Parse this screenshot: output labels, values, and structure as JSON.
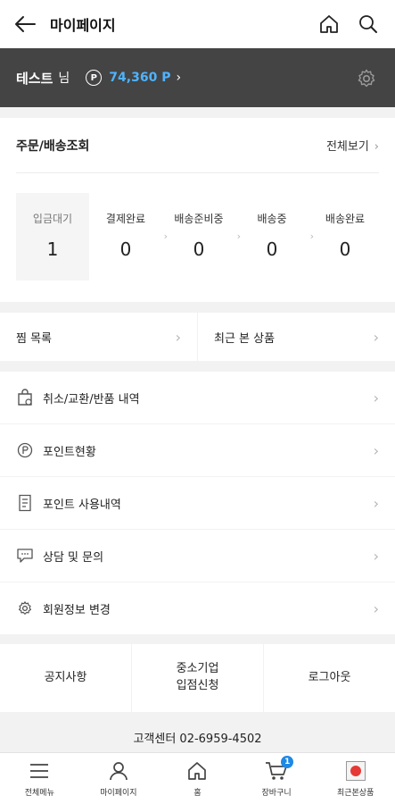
{
  "header": {
    "title": "마이페이지",
    "back_icon": "arrow-left-icon",
    "home_icon": "home-icon",
    "search_icon": "search-icon"
  },
  "user": {
    "name": "테스트",
    "suffix": "님",
    "point_badge": "P",
    "points": "74,360 P",
    "points_chevron": "›",
    "point_color": "#4fb3ff"
  },
  "orders": {
    "title": "주문/배송조회",
    "view_all": "전체보기",
    "chevron": "›",
    "statuses": [
      {
        "label": "입금대기",
        "count": "1"
      },
      {
        "label": "결제완료",
        "count": "0"
      },
      {
        "label": "배송준비중",
        "count": "0"
      },
      {
        "label": "배송중",
        "count": "0"
      },
      {
        "label": "배송완료",
        "count": "0"
      }
    ],
    "separator": "›"
  },
  "shortcuts": [
    {
      "label": "찜 목록"
    },
    {
      "label": "최근 본 상품"
    }
  ],
  "menu": [
    {
      "label": "취소/교환/반품 내역",
      "icon": "shopping-bag-icon"
    },
    {
      "label": "포인트현황",
      "icon": "point-circle-icon"
    },
    {
      "label": "포인트 사용내역",
      "icon": "document-icon"
    },
    {
      "label": "상담 및 문의",
      "icon": "chat-icon"
    },
    {
      "label": "회원정보 변경",
      "icon": "gear-icon"
    }
  ],
  "chevron": "›",
  "footer_buttons": {
    "notice": "공지사항",
    "sme_line1": "중소기업",
    "sme_line2": "입점신청",
    "logout": "로그아웃"
  },
  "customer_center": "고객센터 02-6959-4502",
  "bottom_nav": [
    {
      "label": "전체메뉴",
      "icon": "hamburger-menu-icon"
    },
    {
      "label": "마이페이지",
      "icon": "user-icon"
    },
    {
      "label": "홈",
      "icon": "home-icon"
    },
    {
      "label": "장바구니",
      "icon": "cart-icon",
      "badge": "1"
    },
    {
      "label": "최근본상품",
      "icon": "recent-products-icon"
    }
  ],
  "colors": {
    "accent": "#1e88e5",
    "userbar": "#444444"
  }
}
